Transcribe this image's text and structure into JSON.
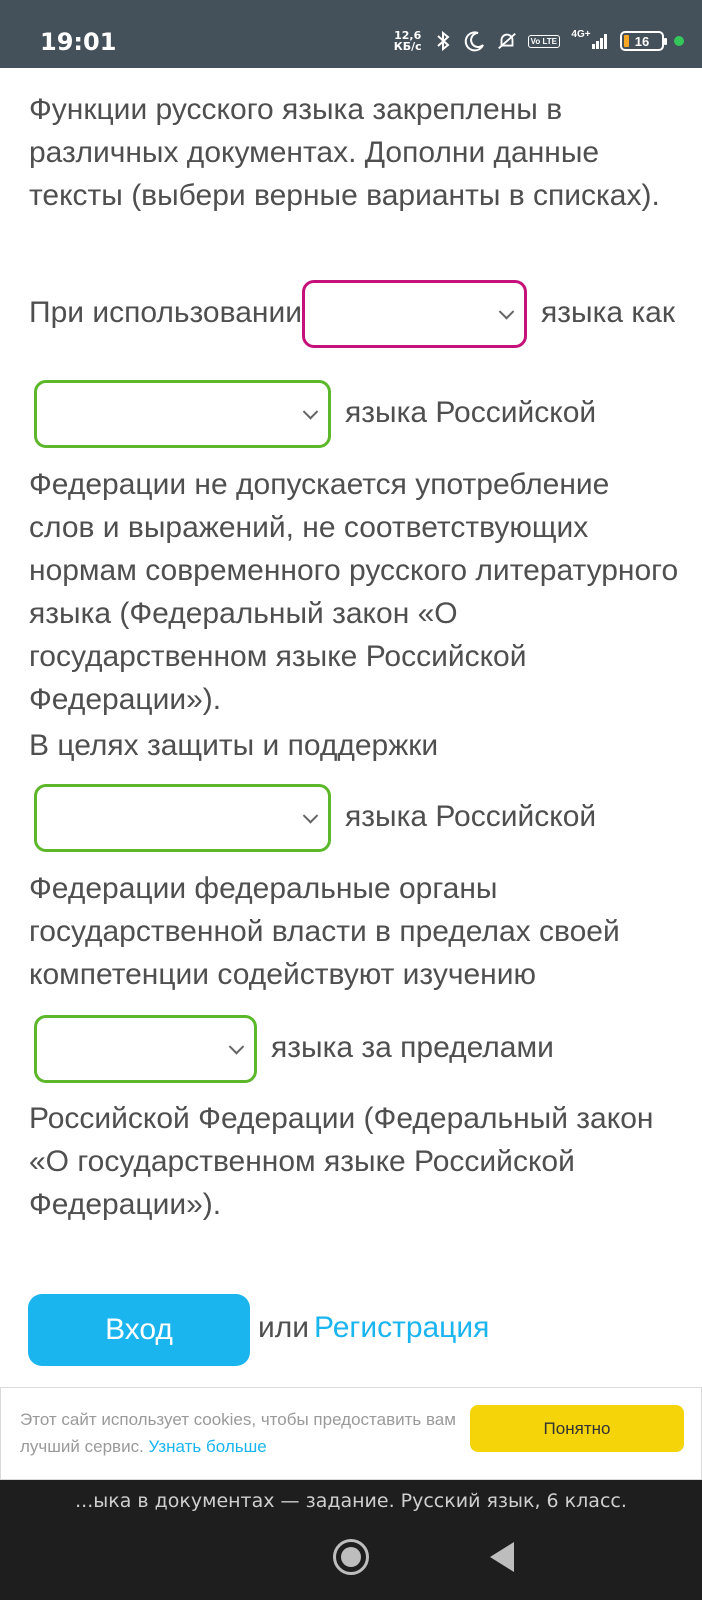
{
  "status_bar": {
    "time": "19:01",
    "net_speed_value": "12,6",
    "net_speed_unit": "КБ/с",
    "volte": "Vo LTE",
    "network": "4G+",
    "battery": "16",
    "icons": [
      "bluetooth-icon",
      "moon-icon",
      "mute-icon",
      "volte-icon",
      "signal-icon",
      "battery-icon"
    ]
  },
  "intro": "Функции русского языка закреплены в различных документах. Дополни данные тексты (выбери верные варианты в списках).",
  "paragraph1": {
    "before_select1": "При использовании",
    "after_select1": "языка как",
    "after_select2": "языка Российской",
    "rest": "Федерации не допускается употребление слов и выражений, не соответствующих нормам современного русского литературного языка (Федеральный закон «О государственном языке Российской Федерации»)."
  },
  "paragraph2": {
    "before_select3": "В целях защиты и поддержки",
    "after_select3": "языка Российской",
    "middle": "Федерации федеральные органы государственной власти в пределах своей компетенции содействуют изучению",
    "after_select4": "языка за пределами",
    "rest": "Российской Федерации (Федеральный закон «О государственном языке Российской Федерации»)."
  },
  "selects": {
    "select1": {
      "value": "",
      "state": "active",
      "border_color": "#c5127b"
    },
    "select2": {
      "value": "",
      "state": "correct",
      "border_color": "#5cb82a"
    },
    "select3": {
      "value": "",
      "state": "correct",
      "border_color": "#5cb82a"
    },
    "select4": {
      "value": "",
      "state": "correct",
      "border_color": "#5cb82a"
    }
  },
  "auth": {
    "login_label": "Вход",
    "or_text": "или",
    "register_label": "Регистрация"
  },
  "cookie": {
    "text": "Этот сайт использует cookies, чтобы предоставить вам лучший сервис.",
    "link": "Узнать больше",
    "button": "Понятно"
  },
  "browser_bottom": {
    "page_title": "...ыка в документах — задание. Русский язык, 6 класс."
  },
  "colors": {
    "accent_blue": "#1ab4ef",
    "status_bar_bg": "#44505a",
    "cookie_button": "#f5d50a"
  }
}
